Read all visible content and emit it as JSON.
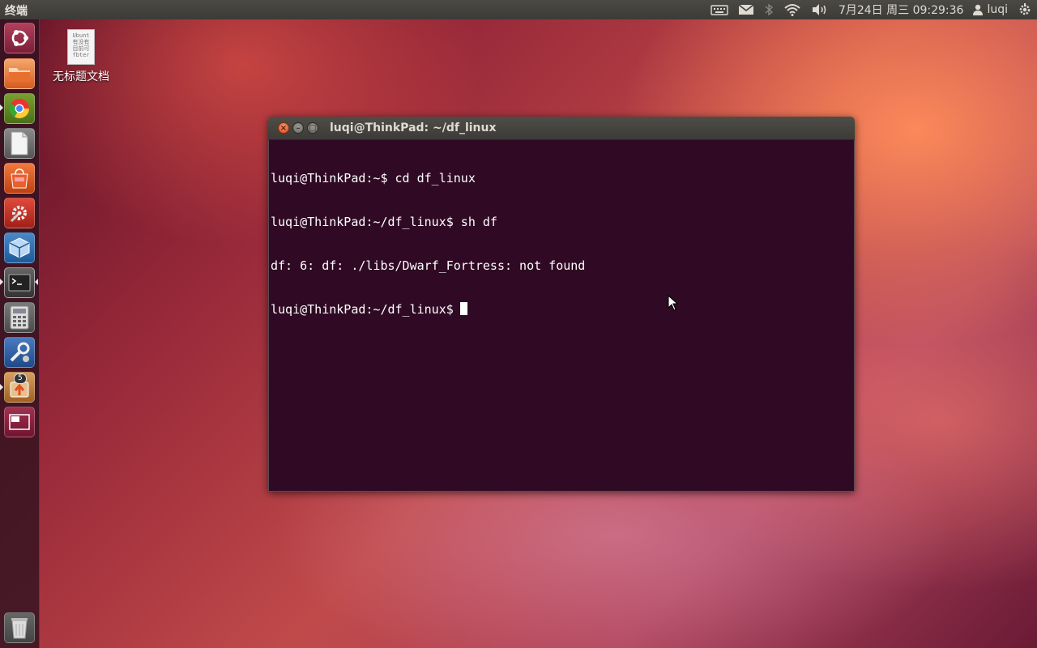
{
  "top_panel": {
    "app_title": "终端",
    "datetime": "7月24日 周三 09:29:36",
    "user": "luqi",
    "icons": [
      "keyboard-icon",
      "mail-icon",
      "bluetooth-icon",
      "wifi-icon",
      "volume-icon",
      "user-icon",
      "session-gear-icon"
    ]
  },
  "launcher": {
    "items": [
      {
        "name": "dash-home",
        "icon": "ubuntu-logo-icon"
      },
      {
        "name": "files",
        "icon": "folder-icon"
      },
      {
        "name": "chrome",
        "icon": "chrome-icon"
      },
      {
        "name": "text-editor",
        "icon": "document-icon"
      },
      {
        "name": "software-center",
        "icon": "shopping-bag-icon"
      },
      {
        "name": "system-settings",
        "icon": "settings-icon"
      },
      {
        "name": "virtualbox",
        "icon": "virtualbox-icon"
      },
      {
        "name": "terminal",
        "icon": "terminal-icon"
      },
      {
        "name": "calculator",
        "icon": "calculator-icon"
      },
      {
        "name": "tweak-tool",
        "icon": "tools-icon"
      },
      {
        "name": "update-manager",
        "icon": "update-icon",
        "badge": "5"
      },
      {
        "name": "workspace-switcher",
        "icon": "workspace-icon"
      },
      {
        "name": "trash",
        "icon": "trash-icon"
      }
    ]
  },
  "desktop": {
    "file_label": "无标题文档",
    "file_preview": "Ubunt\n有没有\n目前可\nfbter"
  },
  "terminal": {
    "title": "luqi@ThinkPad: ~/df_linux",
    "lines": [
      "luqi@ThinkPad:~$ cd df_linux",
      "luqi@ThinkPad:~/df_linux$ sh df",
      "df: 6: df: ./libs/Dwarf_Fortress: not found",
      "luqi@ThinkPad:~/df_linux$"
    ]
  },
  "colors": {
    "terminal_bg": "#300a24",
    "panel_bg": "#3c3b37",
    "close_button": "#e0491b"
  }
}
